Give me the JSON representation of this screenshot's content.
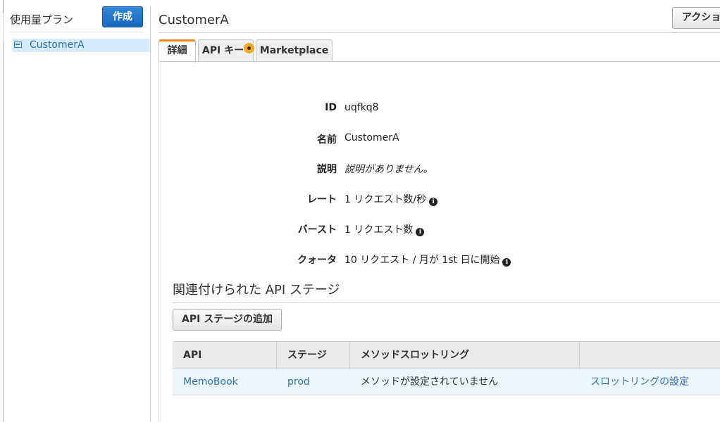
{
  "sidebar": {
    "title": "使用量プラン",
    "create_label": "作成",
    "items": [
      {
        "label": "CustomerA",
        "selected": true
      }
    ]
  },
  "main": {
    "title": "CustomerA",
    "actions_label": "アクション",
    "tabs": [
      {
        "label": "詳細",
        "active": true
      },
      {
        "label": "API キー",
        "badge": true
      },
      {
        "label": "Marketplace"
      }
    ],
    "details": [
      {
        "label": "ID",
        "value": "uqfkq8"
      },
      {
        "label": "名前",
        "value": "CustomerA"
      },
      {
        "label": "説明",
        "value": "説明がありません。"
      },
      {
        "label": "レート",
        "value": "1 リクエスト数/秒"
      },
      {
        "label": "バースト",
        "value": "1 リクエスト数"
      },
      {
        "label": "クォータ",
        "value": "10 リクエスト / 月が 1st 日に開始"
      }
    ],
    "info_glyph": "i"
  },
  "stages": {
    "heading": "関連付けられた API ステージ",
    "add_label": "API ステージの追加",
    "columns": [
      "API",
      "ステージ",
      "メソッドスロットリング",
      ""
    ],
    "rows": [
      {
        "api": "MemoBook",
        "stage": "prod",
        "method_throttling": "メソッドが設定されていません",
        "action": "スロットリングの設定"
      }
    ]
  },
  "colors": {
    "primary_button": "#1f76c9",
    "link": "#2f73b5",
    "active_tab_accent": "#e8871e",
    "badge": "#f5a623",
    "selected_row": "#d6eafb"
  },
  "icons": {
    "plan_item": "usage-plan-icon",
    "tab_badge": "notification-dot-icon",
    "info": "info-icon"
  }
}
